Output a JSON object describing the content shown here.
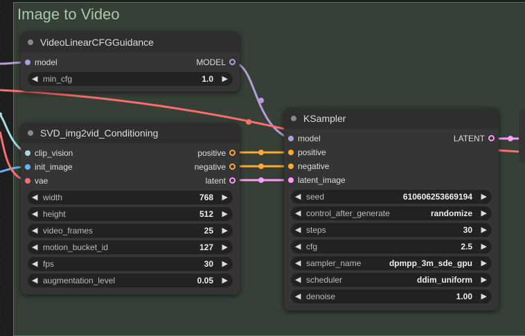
{
  "group": {
    "title": "Image to Video"
  },
  "colors": {
    "model": "#b39ddb",
    "clip_vision": "#a8dadc",
    "image": "#64b5f6",
    "vae": "#ff6e6e",
    "conditioning": "#ffa931",
    "latent": "#ff9cf9"
  },
  "nodes": {
    "guidance": {
      "title": "VideoLinearCFGGuidance",
      "input_model": "model",
      "output_model": "MODEL",
      "widgets": [
        {
          "name": "min_cfg",
          "value": "1.0"
        }
      ]
    },
    "svd": {
      "title": "SVD_img2vid_Conditioning",
      "inputs": [
        "clip_vision",
        "init_image",
        "vae"
      ],
      "outputs": [
        "positive",
        "negative",
        "latent"
      ],
      "widgets": [
        {
          "name": "width",
          "value": "768"
        },
        {
          "name": "height",
          "value": "512"
        },
        {
          "name": "video_frames",
          "value": "25"
        },
        {
          "name": "motion_bucket_id",
          "value": "127"
        },
        {
          "name": "fps",
          "value": "30"
        },
        {
          "name": "augmentation_level",
          "value": "0.05"
        }
      ]
    },
    "ksampler": {
      "title": "KSampler",
      "inputs": [
        "model",
        "positive",
        "negative",
        "latent_image"
      ],
      "output": "LATENT",
      "widgets": [
        {
          "name": "seed",
          "value": "610606253669194"
        },
        {
          "name": "control_after_generate",
          "value": "randomize"
        },
        {
          "name": "steps",
          "value": "30"
        },
        {
          "name": "cfg",
          "value": "2.5"
        },
        {
          "name": "sampler_name",
          "value": "dpmpp_3m_sde_gpu"
        },
        {
          "name": "scheduler",
          "value": "ddim_uniform"
        },
        {
          "name": "denoise",
          "value": "1.00"
        }
      ]
    }
  }
}
